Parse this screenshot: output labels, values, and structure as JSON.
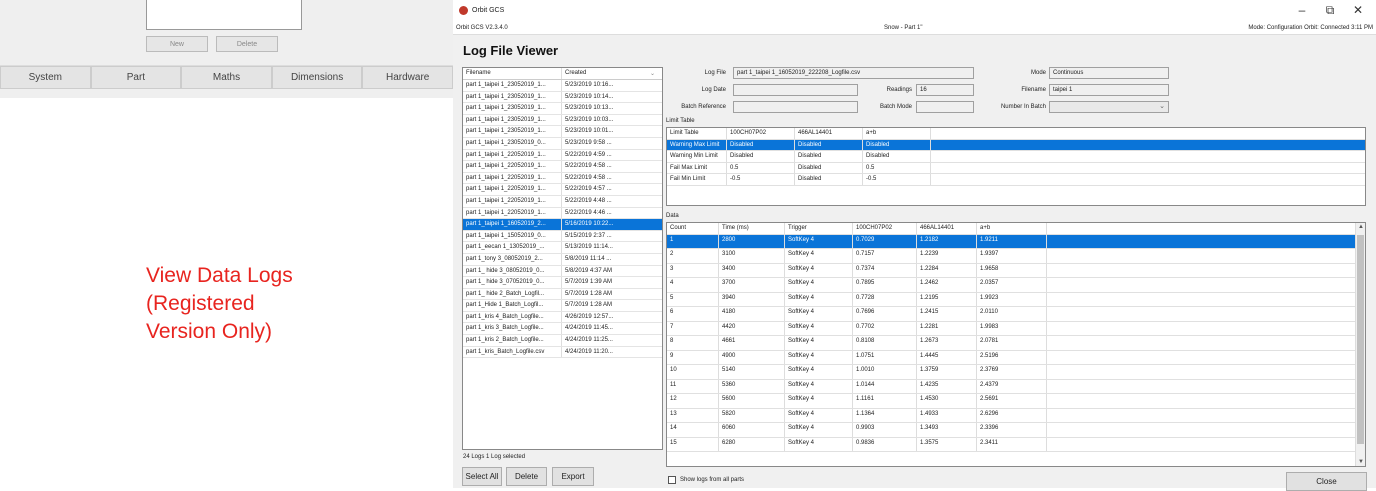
{
  "background": {
    "new_label": "New",
    "delete_label": "Delete",
    "tabs": [
      "System",
      "Part",
      "Maths",
      "Dimensions",
      "Hardware"
    ],
    "promo_lines": [
      "View Data Logs",
      "(Registered",
      "Version Only)"
    ],
    "promo_color": "#e8241f"
  },
  "window": {
    "title": "Orbit GCS",
    "version": "Orbit GCS V2.3.4.0",
    "part": "Snow - Part 1\"",
    "mode_status": "Mode: Configuration  Orbit: Connected 3:11 PM",
    "heading": "Log File Viewer"
  },
  "log_list": {
    "headers": [
      "Filename",
      "Created"
    ],
    "rows": [
      [
        "part 1_taipei 1_23052019_1...",
        "5/23/2019 10:16..."
      ],
      [
        "part 1_taipei 1_23052019_1...",
        "5/23/2019 10:14..."
      ],
      [
        "part 1_taipei 1_23052019_1...",
        "5/23/2019 10:13..."
      ],
      [
        "part 1_taipei 1_23052019_1...",
        "5/23/2019 10:03..."
      ],
      [
        "part 1_taipei 1_23052019_1...",
        "5/23/2019 10:01..."
      ],
      [
        "part 1_taipei 1_23052019_0...",
        "5/23/2019 9:58 ..."
      ],
      [
        "part 1_taipei 1_22052019_1...",
        "5/22/2019 4:59 ..."
      ],
      [
        "part 1_taipei 1_22052019_1...",
        "5/22/2019 4:58 ..."
      ],
      [
        "part 1_taipei 1_22052019_1...",
        "5/22/2019 4:58 ..."
      ],
      [
        "part 1_taipei 1_22052019_1...",
        "5/22/2019 4:57 ..."
      ],
      [
        "part 1_taipei 1_22052019_1...",
        "5/22/2019 4:48 ..."
      ],
      [
        "part 1_taipei 1_22052019_1...",
        "5/22/2019 4:46 ..."
      ],
      [
        "part 1_taipei 1_16052019_2...",
        "5/16/2019 10:22..."
      ],
      [
        "part 1_taipei 1_15052019_0...",
        "5/15/2019 2:37 ..."
      ],
      [
        "part 1_eecan 1_13052019_...",
        "5/13/2019 11:14..."
      ],
      [
        "part 1_tony 3_08052019_2...",
        "5/8/2019 11:14 ..."
      ],
      [
        "part 1_ hide 3_08052019_0...",
        "5/8/2019 4:37 AM"
      ],
      [
        "part 1_ hide 3_07052019_0...",
        "5/7/2019 1:39 AM"
      ],
      [
        "part 1_ hide 2_Batch_Logfil...",
        "5/7/2019 1:28 AM"
      ],
      [
        "part 1_Hide 1_Batch_Logfil...",
        "5/7/2019 1:28 AM"
      ],
      [
        "part 1_kris 4_Batch_Logfile...",
        "4/26/2019 12:57..."
      ],
      [
        "part 1_kris 3_Batch_Logfile...",
        "4/24/2019 11:45..."
      ],
      [
        "part 1_kris 2_Batch_Logfile...",
        "4/24/2019 11:25..."
      ],
      [
        "part 1_kris_Batch_Logfile.csv",
        "4/24/2019 11:20..."
      ]
    ],
    "selected_index": 12,
    "status": "24 Logs  1 Log selected"
  },
  "buttons": {
    "select_all": "Select All",
    "delete": "Delete",
    "export": "Export",
    "close": "Close"
  },
  "fields": {
    "log_file_label": "Log File",
    "log_file": "part 1_taipei 1_16052019_222208_Logfile.csv",
    "log_date_label": "Log Date",
    "log_date": "",
    "readings_label": "Readings",
    "readings": "16",
    "batch_ref_label": "Batch Reference",
    "batch_ref": "",
    "batch_mode_label": "Batch Mode",
    "batch_mode": "",
    "mode_label": "Mode",
    "mode": "Continuous",
    "filename_label": "Filename",
    "filename": "taipei 1",
    "number_in_batch_label": "Number In Batch",
    "number_in_batch": ""
  },
  "limit_table": {
    "label": "Limit Table",
    "headers": [
      "Limit Table",
      "100CH07P02",
      "466AL14401",
      "a+b"
    ],
    "rows": [
      [
        "Warning Max Limit",
        "Disabled",
        "Disabled",
        "Disabled"
      ],
      [
        "Warning Min Limit",
        "Disabled",
        "Disabled",
        "Disabled"
      ],
      [
        "Fail Max Limit",
        "0.5",
        "Disabled",
        "0.5"
      ],
      [
        "Fail Min Limit",
        "-0.5",
        "Disabled",
        "-0.5"
      ]
    ],
    "selected_index": 0
  },
  "data_table": {
    "label": "Data",
    "headers": [
      "Count",
      "Time (ms)",
      "Trigger",
      "100CH07P02",
      "466AL14401",
      "a+b"
    ],
    "rows": [
      [
        "1",
        "2800",
        "SoftKey 4",
        "0.7029",
        "1.2182",
        "1.9211"
      ],
      [
        "2",
        "3100",
        "SoftKey 4",
        "0.7157",
        "1.2239",
        "1.9397"
      ],
      [
        "3",
        "3400",
        "SoftKey 4",
        "0.7374",
        "1.2284",
        "1.9658"
      ],
      [
        "4",
        "3700",
        "SoftKey 4",
        "0.7895",
        "1.2462",
        "2.0357"
      ],
      [
        "5",
        "3940",
        "SoftKey 4",
        "0.7728",
        "1.2195",
        "1.9923"
      ],
      [
        "6",
        "4180",
        "SoftKey 4",
        "0.7696",
        "1.2415",
        "2.0110"
      ],
      [
        "7",
        "4420",
        "SoftKey 4",
        "0.7702",
        "1.2281",
        "1.9983"
      ],
      [
        "8",
        "4661",
        "SoftKey 4",
        "0.8108",
        "1.2673",
        "2.0781"
      ],
      [
        "9",
        "4900",
        "SoftKey 4",
        "1.0751",
        "1.4445",
        "2.5196"
      ],
      [
        "10",
        "5140",
        "SoftKey 4",
        "1.0010",
        "1.3759",
        "2.3769"
      ],
      [
        "11",
        "5360",
        "SoftKey 4",
        "1.0144",
        "1.4235",
        "2.4379"
      ],
      [
        "12",
        "5600",
        "SoftKey 4",
        "1.1161",
        "1.4530",
        "2.5691"
      ],
      [
        "13",
        "5820",
        "SoftKey 4",
        "1.1364",
        "1.4933",
        "2.6296"
      ],
      [
        "14",
        "6060",
        "SoftKey 4",
        "0.9903",
        "1.3493",
        "2.3396"
      ],
      [
        "15",
        "6280",
        "SoftKey 4",
        "0.9836",
        "1.3575",
        "2.3411"
      ]
    ],
    "selected_index": 0
  },
  "show_all_label": "Show logs from all parts",
  "colors": {
    "selection": "#0a74d8",
    "promo": "#e8241f"
  }
}
